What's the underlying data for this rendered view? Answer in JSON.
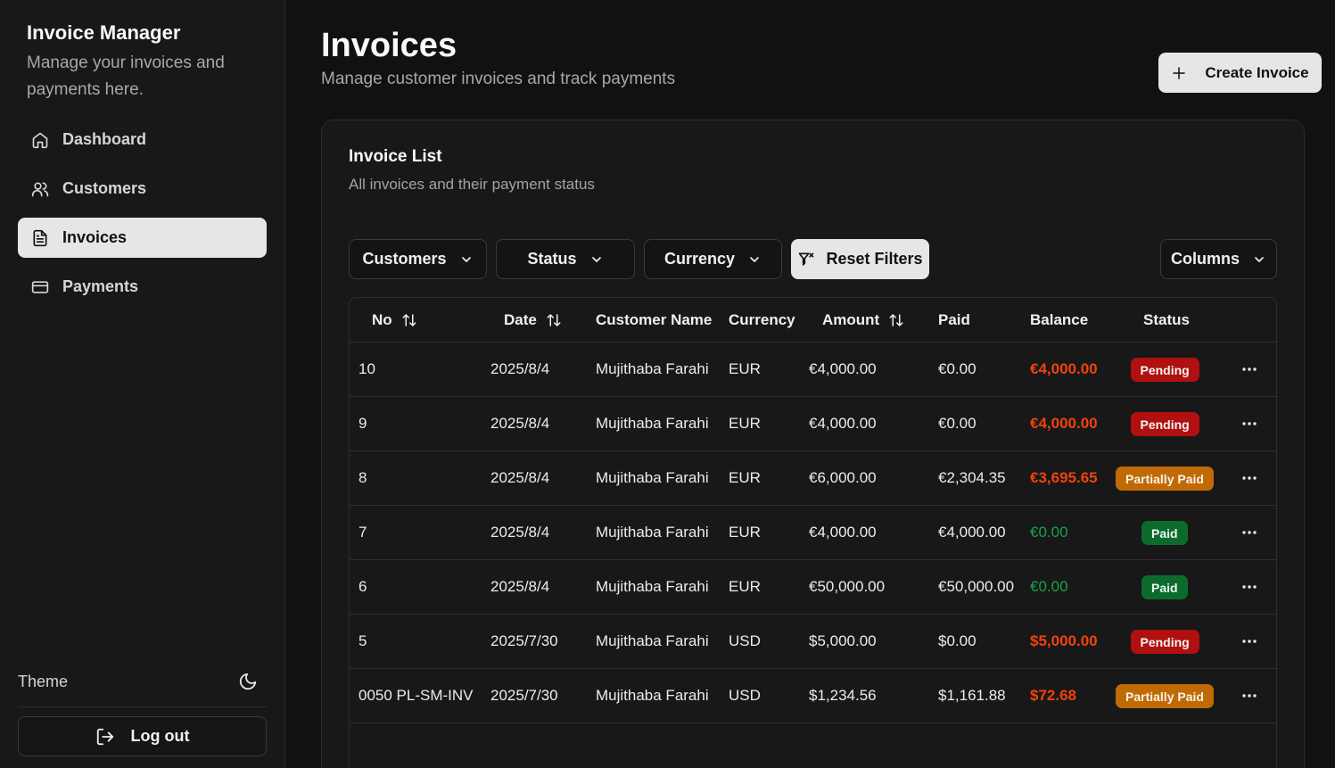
{
  "sidebar": {
    "title": "Invoice Manager",
    "subtitle": "Manage your invoices and payments here.",
    "items": [
      {
        "label": "Dashboard",
        "icon": "home-icon",
        "active": false
      },
      {
        "label": "Customers",
        "icon": "users-icon",
        "active": false
      },
      {
        "label": "Invoices",
        "icon": "file-text-icon",
        "active": true
      },
      {
        "label": "Payments",
        "icon": "credit-card-icon",
        "active": false
      }
    ],
    "theme_label": "Theme",
    "theme_icon": "moon-icon",
    "logout_label": "Log out"
  },
  "header": {
    "title": "Invoices",
    "subtitle": "Manage customer invoices and track payments",
    "create_label": "Create Invoice"
  },
  "card": {
    "title": "Invoice List",
    "subtitle": "All invoices and their payment status"
  },
  "filters": {
    "customers": "Customers",
    "status": "Status",
    "currency": "Currency",
    "reset": "Reset Filters",
    "columns": "Columns"
  },
  "table": {
    "columns": [
      "No",
      "Date",
      "Customer Name",
      "Currency",
      "Amount",
      "Paid",
      "Balance",
      "Status"
    ],
    "rows": [
      {
        "no": "10",
        "date": "2025/8/4",
        "customer": "Mujithaba Farahi",
        "currency": "EUR",
        "amount": "€4,000.00",
        "paid": "€0.00",
        "balance": "€4,000.00",
        "status": "Pending"
      },
      {
        "no": "9",
        "date": "2025/8/4",
        "customer": "Mujithaba Farahi",
        "currency": "EUR",
        "amount": "€4,000.00",
        "paid": "€0.00",
        "balance": "€4,000.00",
        "status": "Pending"
      },
      {
        "no": "8",
        "date": "2025/8/4",
        "customer": "Mujithaba Farahi",
        "currency": "EUR",
        "amount": "€6,000.00",
        "paid": "€2,304.35",
        "balance": "€3,695.65",
        "status": "Partially Paid"
      },
      {
        "no": "7",
        "date": "2025/8/4",
        "customer": "Mujithaba Farahi",
        "currency": "EUR",
        "amount": "€4,000.00",
        "paid": "€4,000.00",
        "balance": "€0.00",
        "status": "Paid"
      },
      {
        "no": "6",
        "date": "2025/8/4",
        "customer": "Mujithaba Farahi",
        "currency": "EUR",
        "amount": "€50,000.00",
        "paid": "€50,000.00",
        "balance": "€0.00",
        "status": "Paid"
      },
      {
        "no": "5",
        "date": "2025/7/30",
        "customer": "Mujithaba Farahi",
        "currency": "USD",
        "amount": "$5,000.00",
        "paid": "$0.00",
        "balance": "$5,000.00",
        "status": "Pending"
      },
      {
        "no": "0050 PL-SM-INV",
        "date": "2025/7/30",
        "customer": "Mujithaba Farahi",
        "currency": "USD",
        "amount": "$1,234.56",
        "paid": "$1,161.88",
        "balance": "$72.68",
        "status": "Partially Paid"
      }
    ]
  },
  "colors": {
    "pending": "#b01010",
    "partial": "#c06a05",
    "paid": "#0c6b2c",
    "balance_due": "#f0420e",
    "balance_clear": "#16a34a"
  }
}
